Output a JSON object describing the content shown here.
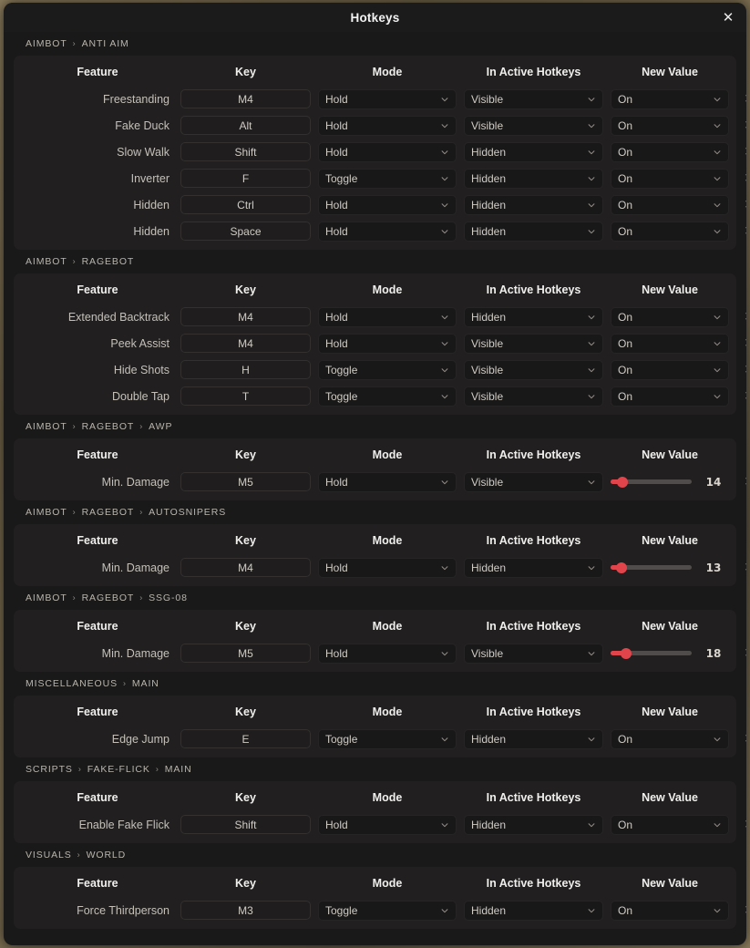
{
  "window": {
    "title": "Hotkeys",
    "close_icon": "close-icon",
    "close_label": "✕"
  },
  "columns": {
    "feature": "Feature",
    "key": "Key",
    "mode": "Mode",
    "in_active_hotkeys": "In Active Hotkeys",
    "new_value": "New Value"
  },
  "icons": {
    "chevron_down": "chevron-down-icon",
    "remove": "×"
  },
  "colors": {
    "accent": "#e2444c",
    "panel_bg": "#191919",
    "card_bg": "#211f1f",
    "text_primary": "#f0efed",
    "text_secondary": "#c4c0b9",
    "breadcrumb": "#b9b5ad"
  },
  "sections": [
    {
      "breadcrumb": [
        "AIMBOT",
        "ANTI AIM"
      ],
      "rows": [
        {
          "feature": "Freestanding",
          "key": "M4",
          "mode": "Hold",
          "visibility": "Visible",
          "value_type": "dropdown",
          "value": "On"
        },
        {
          "feature": "Fake Duck",
          "key": "Alt",
          "mode": "Hold",
          "visibility": "Visible",
          "value_type": "dropdown",
          "value": "On"
        },
        {
          "feature": "Slow Walk",
          "key": "Shift",
          "mode": "Hold",
          "visibility": "Hidden",
          "value_type": "dropdown",
          "value": "On"
        },
        {
          "feature": "Inverter",
          "key": "F",
          "mode": "Toggle",
          "visibility": "Hidden",
          "value_type": "dropdown",
          "value": "On"
        },
        {
          "feature": "Hidden",
          "key": "Ctrl",
          "mode": "Hold",
          "visibility": "Hidden",
          "value_type": "dropdown",
          "value": "On"
        },
        {
          "feature": "Hidden",
          "key": "Space",
          "mode": "Hold",
          "visibility": "Hidden",
          "value_type": "dropdown",
          "value": "On"
        }
      ]
    },
    {
      "breadcrumb": [
        "AIMBOT",
        "RAGEBOT"
      ],
      "rows": [
        {
          "feature": "Extended Backtrack",
          "key": "M4",
          "mode": "Hold",
          "visibility": "Hidden",
          "value_type": "dropdown",
          "value": "On"
        },
        {
          "feature": "Peek Assist",
          "key": "M4",
          "mode": "Hold",
          "visibility": "Visible",
          "value_type": "dropdown",
          "value": "On"
        },
        {
          "feature": "Hide Shots",
          "key": "H",
          "mode": "Toggle",
          "visibility": "Visible",
          "value_type": "dropdown",
          "value": "On"
        },
        {
          "feature": "Double Tap",
          "key": "T",
          "mode": "Toggle",
          "visibility": "Visible",
          "value_type": "dropdown",
          "value": "On"
        }
      ]
    },
    {
      "breadcrumb": [
        "AIMBOT",
        "RAGEBOT",
        "AWP"
      ],
      "rows": [
        {
          "feature": "Min. Damage",
          "key": "M5",
          "mode": "Hold",
          "visibility": "Visible",
          "value_type": "slider",
          "value": "14",
          "slider_percent": 15
        }
      ]
    },
    {
      "breadcrumb": [
        "AIMBOT",
        "RAGEBOT",
        "AUTOSNIPERS"
      ],
      "rows": [
        {
          "feature": "Min. Damage",
          "key": "M4",
          "mode": "Hold",
          "visibility": "Hidden",
          "value_type": "slider",
          "value": "13",
          "slider_percent": 14
        }
      ]
    },
    {
      "breadcrumb": [
        "AIMBOT",
        "RAGEBOT",
        "SSG-08"
      ],
      "rows": [
        {
          "feature": "Min. Damage",
          "key": "M5",
          "mode": "Hold",
          "visibility": "Visible",
          "value_type": "slider",
          "value": "18",
          "slider_percent": 19
        }
      ]
    },
    {
      "breadcrumb": [
        "MISCELLANEOUS",
        "MAIN"
      ],
      "rows": [
        {
          "feature": "Edge Jump",
          "key": "E",
          "mode": "Toggle",
          "visibility": "Hidden",
          "value_type": "dropdown",
          "value": "On"
        }
      ]
    },
    {
      "breadcrumb": [
        "SCRIPTS",
        "FAKE-FLICK",
        "MAIN"
      ],
      "rows": [
        {
          "feature": "Enable Fake Flick",
          "key": "Shift",
          "mode": "Hold",
          "visibility": "Hidden",
          "value_type": "dropdown",
          "value": "On"
        }
      ]
    },
    {
      "breadcrumb": [
        "VISUALS",
        "WORLD"
      ],
      "rows": [
        {
          "feature": "Force Thirdperson",
          "key": "M3",
          "mode": "Toggle",
          "visibility": "Hidden",
          "value_type": "dropdown",
          "value": "On"
        }
      ]
    }
  ]
}
